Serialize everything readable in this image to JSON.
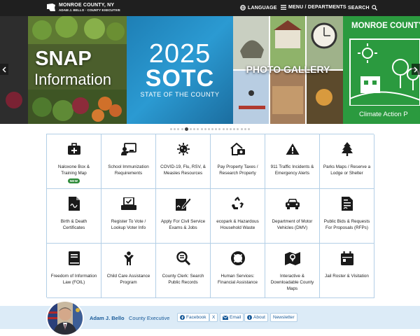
{
  "header": {
    "logo_title": "MONROE COUNTY, NY",
    "logo_subtitle": "ADAM J. BELLO · COUNTY EXECUTIVE",
    "language_label": "LANGUAGE",
    "menu_label": "MENU / DEPARTMENTS",
    "search_label": "SEARCH"
  },
  "carousel": {
    "snap": {
      "title": "SNAP",
      "subtitle": "Information"
    },
    "sotc": {
      "year": "2025",
      "title": "SOTC",
      "subtitle": "STATE OF THE COUNTY"
    },
    "photo": {
      "title": "PHOTO GALLERY"
    },
    "climate": {
      "title": "MONROE COUNTY",
      "subtitle": "Climate Action P"
    },
    "dot_count": 22,
    "active_dot": 4
  },
  "tiles": [
    {
      "label": "Naloxone Box & Training Map",
      "icon": "first-aid-kit-icon",
      "badge": "NEW"
    },
    {
      "label": "School Immunization Requirements",
      "icon": "teacher-board-icon"
    },
    {
      "label": "COVID-19, Flu, RSV, & Measles Resources",
      "icon": "virus-icon"
    },
    {
      "label": "Pay Property Taxes / Research Property",
      "icon": "house-dollar-icon"
    },
    {
      "label": "911 Traffic Incidents & Emergency Alerts",
      "icon": "warning-icon"
    },
    {
      "label": "Parks Maps / Reserve a Lodge or Shelter",
      "icon": "tree-icon"
    },
    {
      "label": "Birth & Death Certificates",
      "icon": "certificate-icon"
    },
    {
      "label": "Register To Vote / Lookup Voter Info",
      "icon": "ballot-box-icon"
    },
    {
      "label": "Apply For Civil Service Exams & Jobs",
      "icon": "signature-icon"
    },
    {
      "label": "ecopark & Hazardous Household Waste",
      "icon": "recycle-icon"
    },
    {
      "label": "Department of Motor Vehicles (DMV)",
      "icon": "car-icon"
    },
    {
      "label": "Public Bids & Requests For Proposals (RFPs)",
      "icon": "contract-icon"
    },
    {
      "label": "Freedom of Information Law (FOIL)",
      "icon": "book-icon"
    },
    {
      "label": "Child Care Assistance Program",
      "icon": "child-icon"
    },
    {
      "label": "County Clerk: Search Public Records",
      "icon": "magnify-document-icon"
    },
    {
      "label": "Human Services: Financial Assistance",
      "icon": "life-ring-icon"
    },
    {
      "label": "Interactive & Downloadable County Maps",
      "icon": "map-pin-icon"
    },
    {
      "label": "Jail Roster & Visitation",
      "icon": "calendar-icon"
    }
  ],
  "footer": {
    "name": "Adam J. Bello",
    "title": "County Executive",
    "links": [
      "Facebook",
      "X",
      "Email",
      "About",
      "Newsletter"
    ]
  },
  "colors": {
    "header_bg": "#1f1f1f",
    "tile_border": "#b3cfe6",
    "footer_bg": "#dcebf7",
    "link": "#1b5c9a",
    "badge": "#2e8b3a"
  }
}
